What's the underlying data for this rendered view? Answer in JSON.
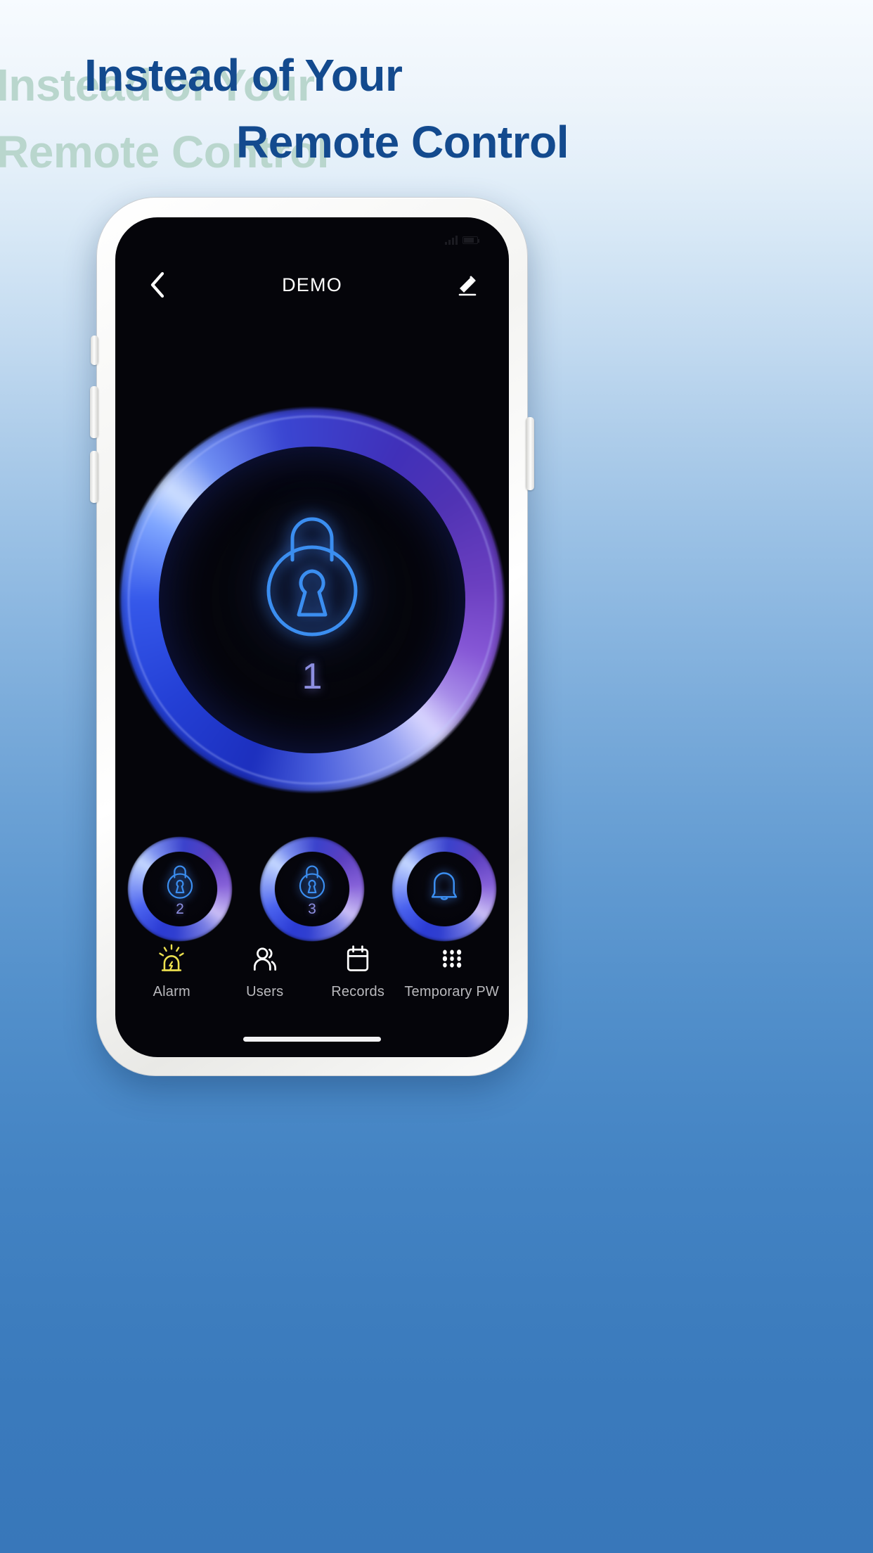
{
  "banner": {
    "line1": "Instead of Your",
    "line2": "Remote Control",
    "text_color": "#134a8e",
    "shadow_color": "#b9d6cd",
    "background_top": "#f7fbff",
    "background_bottom": "#3877ba"
  },
  "phone": {
    "status_bar": {
      "time": "",
      "signal_icon": "signal-bars-icon",
      "battery_icon": "battery-icon"
    },
    "navbar": {
      "back_icon": "chevron-left-icon",
      "title": "DEMO",
      "edit_icon": "pencil-edit-icon"
    },
    "main_dial": {
      "icon": "padlock-icon",
      "number": "1",
      "ring_colors": [
        "#1c2fbe",
        "#3558ea",
        "#cfe0ff",
        "#6b3fc0",
        "#a78ce8"
      ],
      "number_color": "#8e8fe0"
    },
    "secondary_buttons": [
      {
        "icon": "padlock-icon",
        "number": "2"
      },
      {
        "icon": "padlock-icon",
        "number": "3"
      },
      {
        "icon": "bell-icon",
        "number": ""
      }
    ],
    "tabbar": {
      "items": [
        {
          "label": "Alarm",
          "icon": "alarm-siren-icon",
          "color": "#ece04f",
          "active": true
        },
        {
          "label": "Users",
          "icon": "users-icon",
          "color": "#ffffff",
          "active": false
        },
        {
          "label": "Records",
          "icon": "calendar-icon",
          "color": "#ffffff",
          "active": false
        },
        {
          "label": "Temporary PW",
          "icon": "keypad-dots-icon",
          "color": "#ffffff",
          "active": false
        }
      ],
      "label_color": "#b9b9bd"
    },
    "home_indicator": "home-indicator"
  }
}
